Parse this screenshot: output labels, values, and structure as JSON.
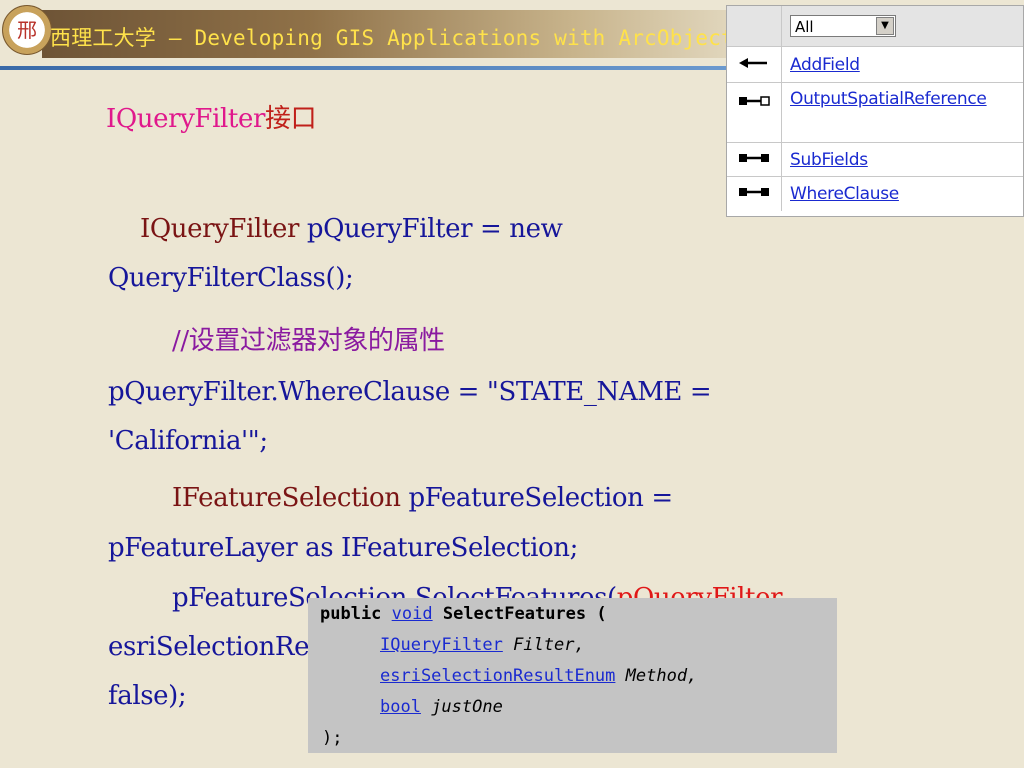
{
  "header": {
    "logo_glyph": "邢",
    "title": "西理工大学 — Developing GIS Applications with ArcObjects"
  },
  "slide": {
    "heading": "IQueryFilter",
    "heading_cn": "接口",
    "code": {
      "l1_kw": "IQueryFilter",
      "l1_rest": " pQueryFilter = new",
      "l2": "QueryFilterClass();",
      "l3": "//设置过滤器对象的属性",
      "l4": "pQueryFilter.WhereClause = \"STATE_NAME =",
      "l5": "'California'\";",
      "l6_kw": "IFeatureSelection",
      "l6_rest": " pFeatureSelection =",
      "l7": "pFeatureLayer as IFeatureSelection;",
      "l8a": "pFeatureSelection.SelectFeatures(",
      "l8b": "pQueryFilter",
      "l8c": ",",
      "l9": "esriSelectionResultEnum.esriSelectionResultNew,",
      "l10": "false);"
    }
  },
  "members_panel": {
    "filter_value": "All",
    "members": [
      {
        "name": "AddField",
        "icon": "method-left-arrow-icon"
      },
      {
        "name": "OutputSpatialReference",
        "icon": "property-readwrite-icon"
      },
      {
        "name": "SubFields",
        "icon": "property-both-icon"
      },
      {
        "name": "WhereClause",
        "icon": "property-both-icon"
      }
    ]
  },
  "signature": {
    "l1_pub": "public ",
    "l1_void": "void",
    "l1_name": " SelectFeatures (",
    "p1_type": "IQueryFilter",
    "p1_name": " Filter,",
    "p2_type": "esriSelectionResultEnum",
    "p2_name": " Method,",
    "p3_type": "bool",
    "p3_name": " justOne",
    "close": ");"
  }
}
